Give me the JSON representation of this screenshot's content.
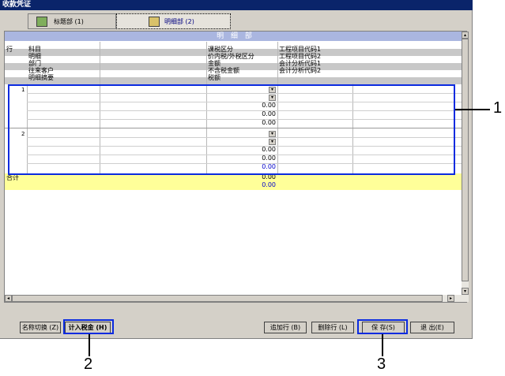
{
  "window": {
    "title": "收款凭证"
  },
  "tabs": [
    {
      "label": "标题部 (1)"
    },
    {
      "label": "明细部 (2)"
    }
  ],
  "section": {
    "title": "明 细 部"
  },
  "headers": {
    "row_col": "行",
    "c1": [
      "科目",
      "明细",
      "部门",
      "往来客户",
      "明细摘要"
    ],
    "c3": [
      "课税区分",
      "价内税/外税区分",
      "金额",
      "不含税金额",
      "税额"
    ],
    "c4": [
      "工程项目代码1",
      "工程项目代码2",
      "会计分析代码1",
      "会计分析代码2"
    ]
  },
  "entries": [
    {
      "row": "1",
      "values": [
        "0.00",
        "0.00",
        "0.00",
        "0.00"
      ]
    },
    {
      "row": "2",
      "values": [
        "0.00",
        "0.00",
        "0.00",
        "0.00"
      ]
    }
  ],
  "total": {
    "label": "合计",
    "values": [
      "0.00",
      "0.00"
    ]
  },
  "buttons": {
    "rename": "名称切换 (Z)",
    "tax": "计入税金 (H)",
    "add_row": "追加行 (B)",
    "delete_row": "删除行 (L)",
    "save": "保  存(S)",
    "exit": "退  出(E)"
  },
  "callouts": [
    "1",
    "2",
    "3"
  ],
  "colors": {
    "title_bar": "#0a246a",
    "section_header": "#aab6e0",
    "total_row": "#ffff99",
    "callout": "#0b2be0"
  }
}
